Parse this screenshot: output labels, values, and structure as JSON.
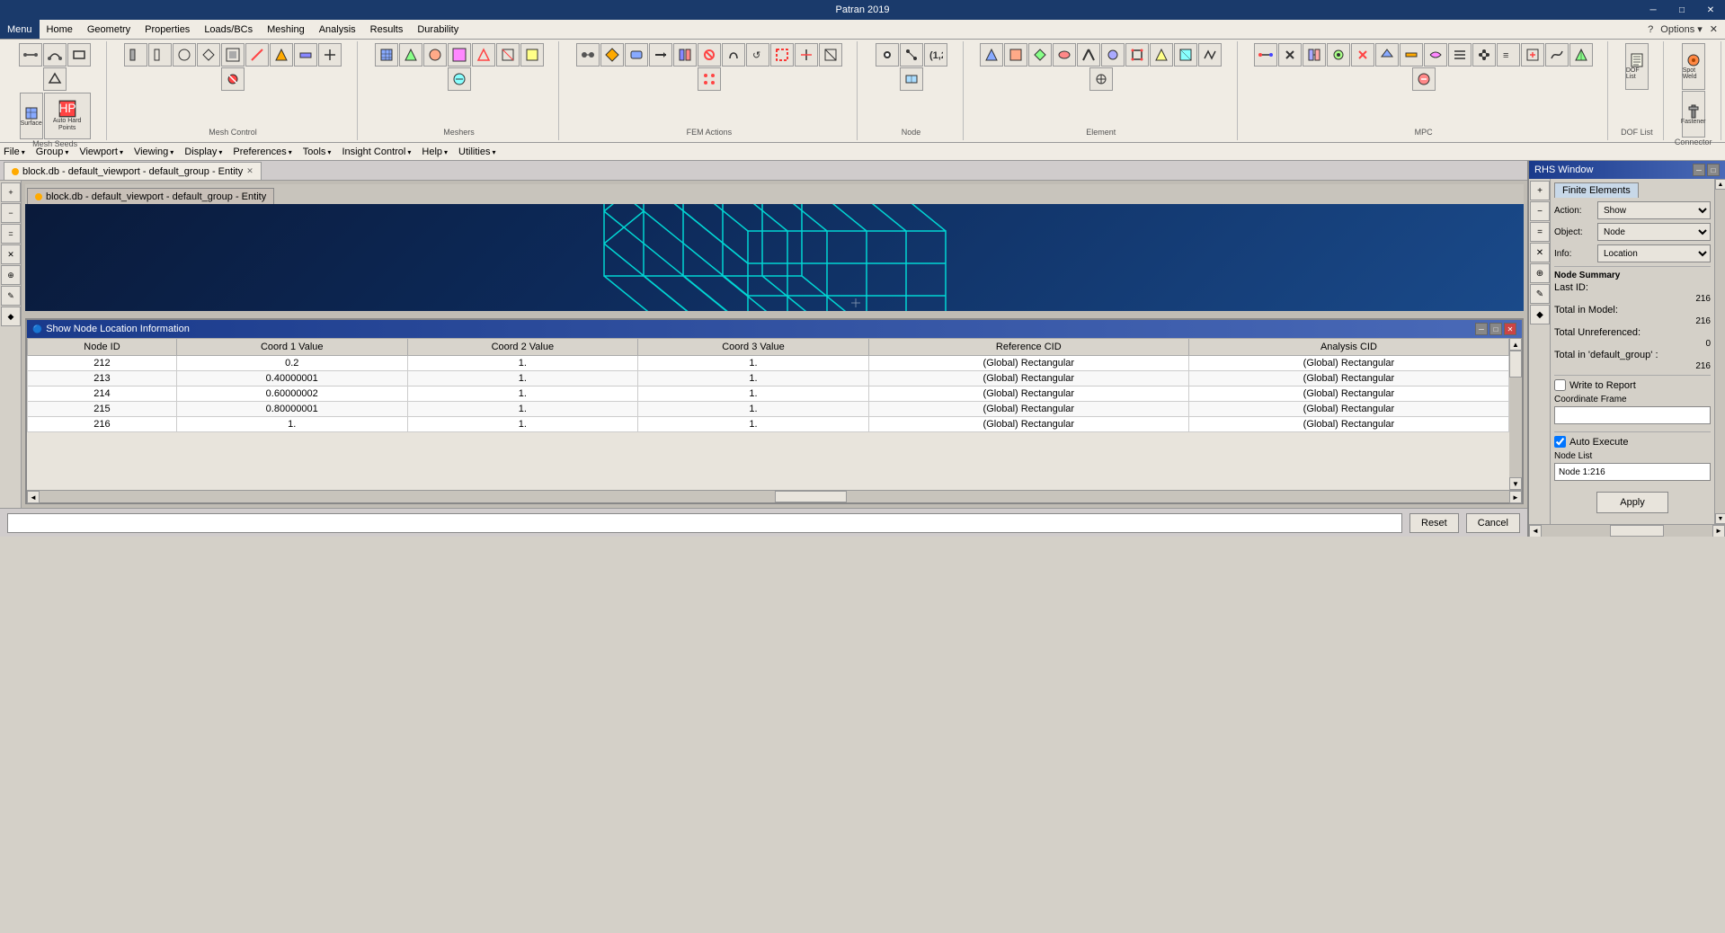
{
  "app": {
    "title": "Patran 2019",
    "window_controls": [
      "─",
      "□",
      "✕"
    ]
  },
  "menu_bar": {
    "items": [
      "Menu",
      "Home",
      "Geometry",
      "Properties",
      "Loads/BCs",
      "Meshing",
      "Analysis",
      "Results",
      "Durability"
    ],
    "active_item": "Menu",
    "right_controls": [
      "?",
      "Options ▾",
      "✕"
    ]
  },
  "toolbar": {
    "groups": [
      {
        "name": "Mesh Seeds",
        "buttons": [
          "line-seed",
          "curve-seed",
          "b1",
          "b2",
          "surface-mesh",
          "auto-hard"
        ]
      },
      {
        "name": "Mesh Control",
        "buttons": [
          "mc1",
          "mc2",
          "mc3",
          "mc4",
          "mc5",
          "mc6",
          "mc7",
          "mc8",
          "mc9",
          "mc10"
        ]
      },
      {
        "name": "Meshers",
        "buttons": [
          "m1",
          "m2",
          "m3",
          "m4",
          "m5",
          "m6",
          "m7",
          "m8"
        ]
      },
      {
        "name": "FEM Actions",
        "buttons": [
          "fe1",
          "fe2",
          "fe3",
          "fe4",
          "fe5",
          "fe6",
          "fe7",
          "fe8",
          "fe9",
          "fe10",
          "fe11",
          "fe12"
        ]
      },
      {
        "name": "Node",
        "buttons": [
          "n1",
          "n2",
          "n3",
          "n4"
        ]
      },
      {
        "name": "Element",
        "buttons": [
          "el1",
          "el2",
          "el3",
          "el4",
          "el5",
          "el6",
          "el7",
          "el8",
          "el9",
          "el10",
          "el11"
        ]
      },
      {
        "name": "MPC",
        "buttons": [
          "mpc1",
          "mpc2",
          "mpc3",
          "mpc4",
          "mpc5",
          "mpc6",
          "mpc7",
          "mpc8",
          "mpc9",
          "mpc10",
          "mpc11",
          "mpc12",
          "mpc13",
          "mpc14",
          "mpc15"
        ]
      },
      {
        "name": "DOF List",
        "buttons": [
          "dof1"
        ]
      },
      {
        "name": "Connector",
        "buttons": [
          "spot-weld",
          "fastener"
        ]
      }
    ],
    "auto_hard_points_label": "Auto Hard Points"
  },
  "secondary_menu": {
    "items": [
      "File",
      "Group",
      "Viewport",
      "Viewing",
      "Display",
      "Preferences",
      "Tools",
      "Insight Control",
      "Help",
      "Utilities"
    ]
  },
  "viewport": {
    "tab_label": "block.db - default_viewport - default_group - Entity",
    "inner_tab_label": "block.db - default_viewport - default_group - Entity",
    "title": "block.db - default_viewport - default_group - Entity",
    "cube": {
      "color": "#00e8e0",
      "grid_lines": 5
    }
  },
  "bottom_panel": {
    "title": "Show Node Location Information",
    "columns": [
      "Node ID",
      "Coord 1 Value",
      "Coord 2 Value",
      "Coord 3 Value",
      "Reference CID",
      "Analysis CID"
    ],
    "rows": [
      {
        "node_id": "212",
        "coord1": "0.2",
        "coord2": "1.",
        "coord3": "1.",
        "ref_cid": "(Global) Rectangular",
        "analysis_cid": "(Global) Rectangular"
      },
      {
        "node_id": "213",
        "coord1": "0.40000001",
        "coord2": "1.",
        "coord3": "1.",
        "ref_cid": "(Global) Rectangular",
        "analysis_cid": "(Global) Rectangular"
      },
      {
        "node_id": "214",
        "coord1": "0.60000002",
        "coord2": "1.",
        "coord3": "1.",
        "ref_cid": "(Global) Rectangular",
        "analysis_cid": "(Global) Rectangular"
      },
      {
        "node_id": "215",
        "coord1": "0.80000001",
        "coord2": "1.",
        "coord3": "1.",
        "ref_cid": "(Global) Rectangular",
        "analysis_cid": "(Global) Rectangular"
      },
      {
        "node_id": "216",
        "coord1": "1.",
        "coord2": "1.",
        "coord3": "1.",
        "ref_cid": "(Global) Rectangular",
        "analysis_cid": "(Global) Rectangular"
      }
    ],
    "buttons": {
      "reset": "Reset",
      "cancel": "Cancel"
    }
  },
  "rhs_panel": {
    "title": "RHS Window",
    "tab": "Finite Elements",
    "action_label": "Action:",
    "action_value": "Show",
    "object_label": "Object:",
    "object_value": "Node",
    "info_label": "Info:",
    "info_value": "Location",
    "node_summary": {
      "title": "Node Summary",
      "last_id_label": "Last ID:",
      "last_id_value": "216",
      "total_model_label": "Total in Model:",
      "total_model_value": "216",
      "total_unreferenced_label": "Total Unreferenced:",
      "total_unreferenced_value": "0",
      "total_group_label": "Total in 'default_group' :",
      "total_group_value": "216"
    },
    "write_to_report_label": "Write to Report",
    "coordinate_frame_label": "Coordinate Frame",
    "coordinate_frame_value": "",
    "auto_execute_label": "Auto Execute",
    "auto_execute_checked": true,
    "node_list_label": "Node List",
    "node_list_value": "Node 1:216",
    "apply_button": "Apply"
  },
  "left_strip_buttons": [
    "+",
    "−",
    "=",
    "✕",
    "⊛",
    "✎",
    "◆"
  ],
  "rhs_side_buttons": [
    "+",
    "−",
    "=",
    "✕",
    "⊛",
    "✎",
    "◆"
  ],
  "status_bar": {
    "text": ""
  }
}
